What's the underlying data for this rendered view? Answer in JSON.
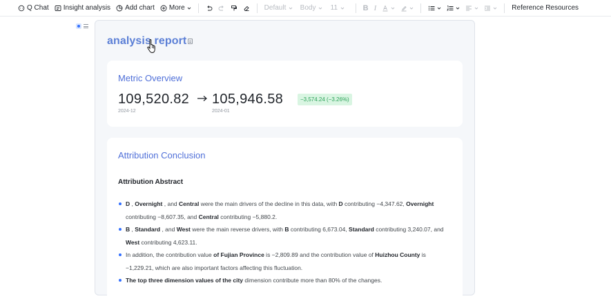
{
  "toolbar": {
    "q_chat": "Q Chat",
    "insight_analysis": "Insight analysis",
    "add_chart": "Add chart",
    "more": "More",
    "font_family": "Default",
    "paragraph_style": "Body",
    "font_size": "11",
    "reference_resources": "Reference Resources"
  },
  "report": {
    "title": "analysis report",
    "metric_overview": {
      "title": "Metric Overview",
      "value_from": "109,520.82",
      "date_from": "2024-12",
      "value_to": "105,946.58",
      "date_to": "2024-01",
      "delta": "−3,574.24 (−3.26%)"
    },
    "attribution": {
      "title": "Attribution Conclusion",
      "abstract_title": "Attribution Abstract",
      "bullets": [
        {
          "p1_b": "D",
          "p2": " , ",
          "p3_b": "Overnight",
          "p4": " , and ",
          "p5_b": "Central",
          "p6": " were the main drivers of the decline in this data, with ",
          "p7_b": "D",
          "p8": " contributing −4,347.62, ",
          "p9_b": "Overnight",
          "p10": " contributing −8,607.35, and ",
          "p11_b": "Central",
          "p12": " contributing −5,880.2."
        },
        {
          "p1_b": "B",
          "p2": " , ",
          "p3_b": "Standard",
          "p4": " , and ",
          "p5_b": "West",
          "p6": " were the main reverse drivers, with ",
          "p7_b": "B",
          "p8": " contributing 6,673.04, ",
          "p9_b": "Standard",
          "p10": " contributing 3,240.07, and ",
          "p11_b": "West",
          "p12": " contributing 4,623.11."
        },
        {
          "p1": "In addition, the contribution value ",
          "p2_b": "of Fujian Province",
          "p3": " is −2,809.89 and the contribution value of ",
          "p4_b": "Huizhou County",
          "p5": " is −1,229.21, which are also important factors affecting this fluctuation."
        },
        {
          "p1_b": "The top three dimension values of the city",
          "p2": " dimension contribute more than 80% of the changes."
        }
      ]
    }
  },
  "colors": {
    "accent": "#3370ff",
    "title_blue": "#5b7fd6",
    "positive_bg": "#d9f5e2",
    "positive_text": "#2ea35a"
  }
}
